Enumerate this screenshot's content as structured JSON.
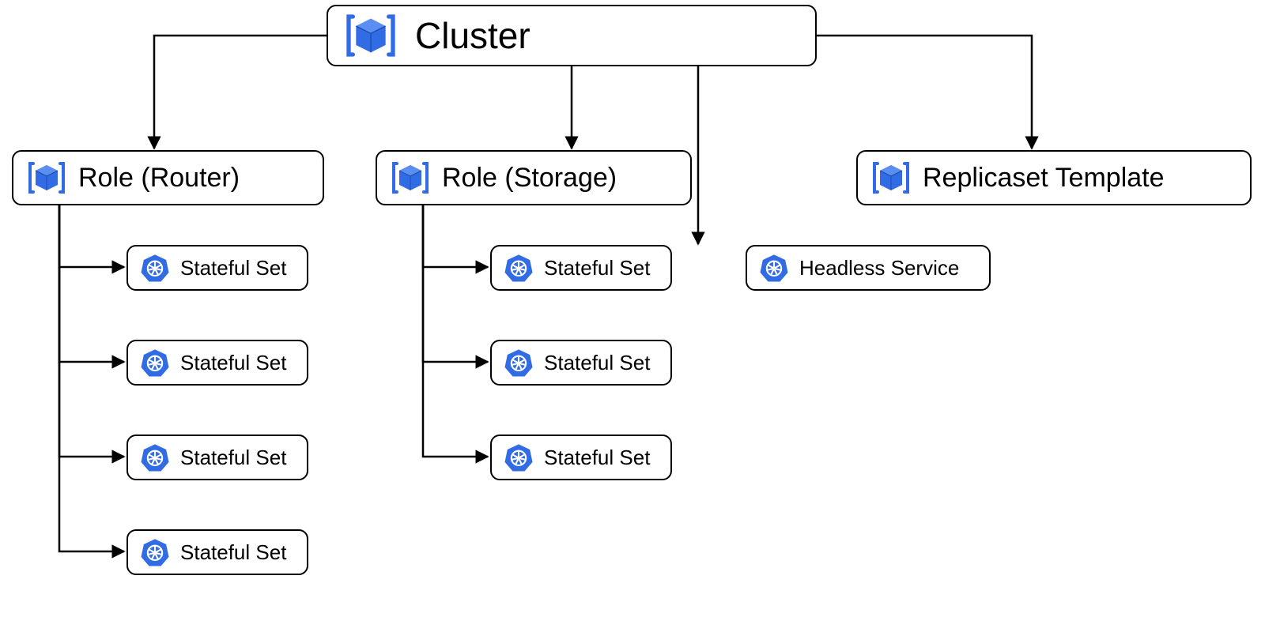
{
  "colors": {
    "accent": "#326ce5",
    "stroke": "#000000"
  },
  "root": {
    "label": "Cluster",
    "icon": "cube-icon"
  },
  "children": [
    {
      "id": "role-router",
      "label": "Role (Router)",
      "icon": "cube-icon",
      "children": [
        {
          "label": "Stateful Set",
          "icon": "kubernetes-icon"
        },
        {
          "label": "Stateful Set",
          "icon": "kubernetes-icon"
        },
        {
          "label": "Stateful Set",
          "icon": "kubernetes-icon"
        },
        {
          "label": "Stateful Set",
          "icon": "kubernetes-icon"
        }
      ]
    },
    {
      "id": "role-storage",
      "label": "Role (Storage)",
      "icon": "cube-icon",
      "children": [
        {
          "label": "Stateful Set",
          "icon": "kubernetes-icon"
        },
        {
          "label": "Stateful Set",
          "icon": "kubernetes-icon"
        },
        {
          "label": "Stateful Set",
          "icon": "kubernetes-icon"
        }
      ]
    },
    {
      "id": "headless-service",
      "label": "Headless Service",
      "icon": "kubernetes-icon",
      "children": []
    },
    {
      "id": "replicaset-template",
      "label": "Replicaset Template",
      "icon": "cube-icon",
      "children": []
    }
  ]
}
